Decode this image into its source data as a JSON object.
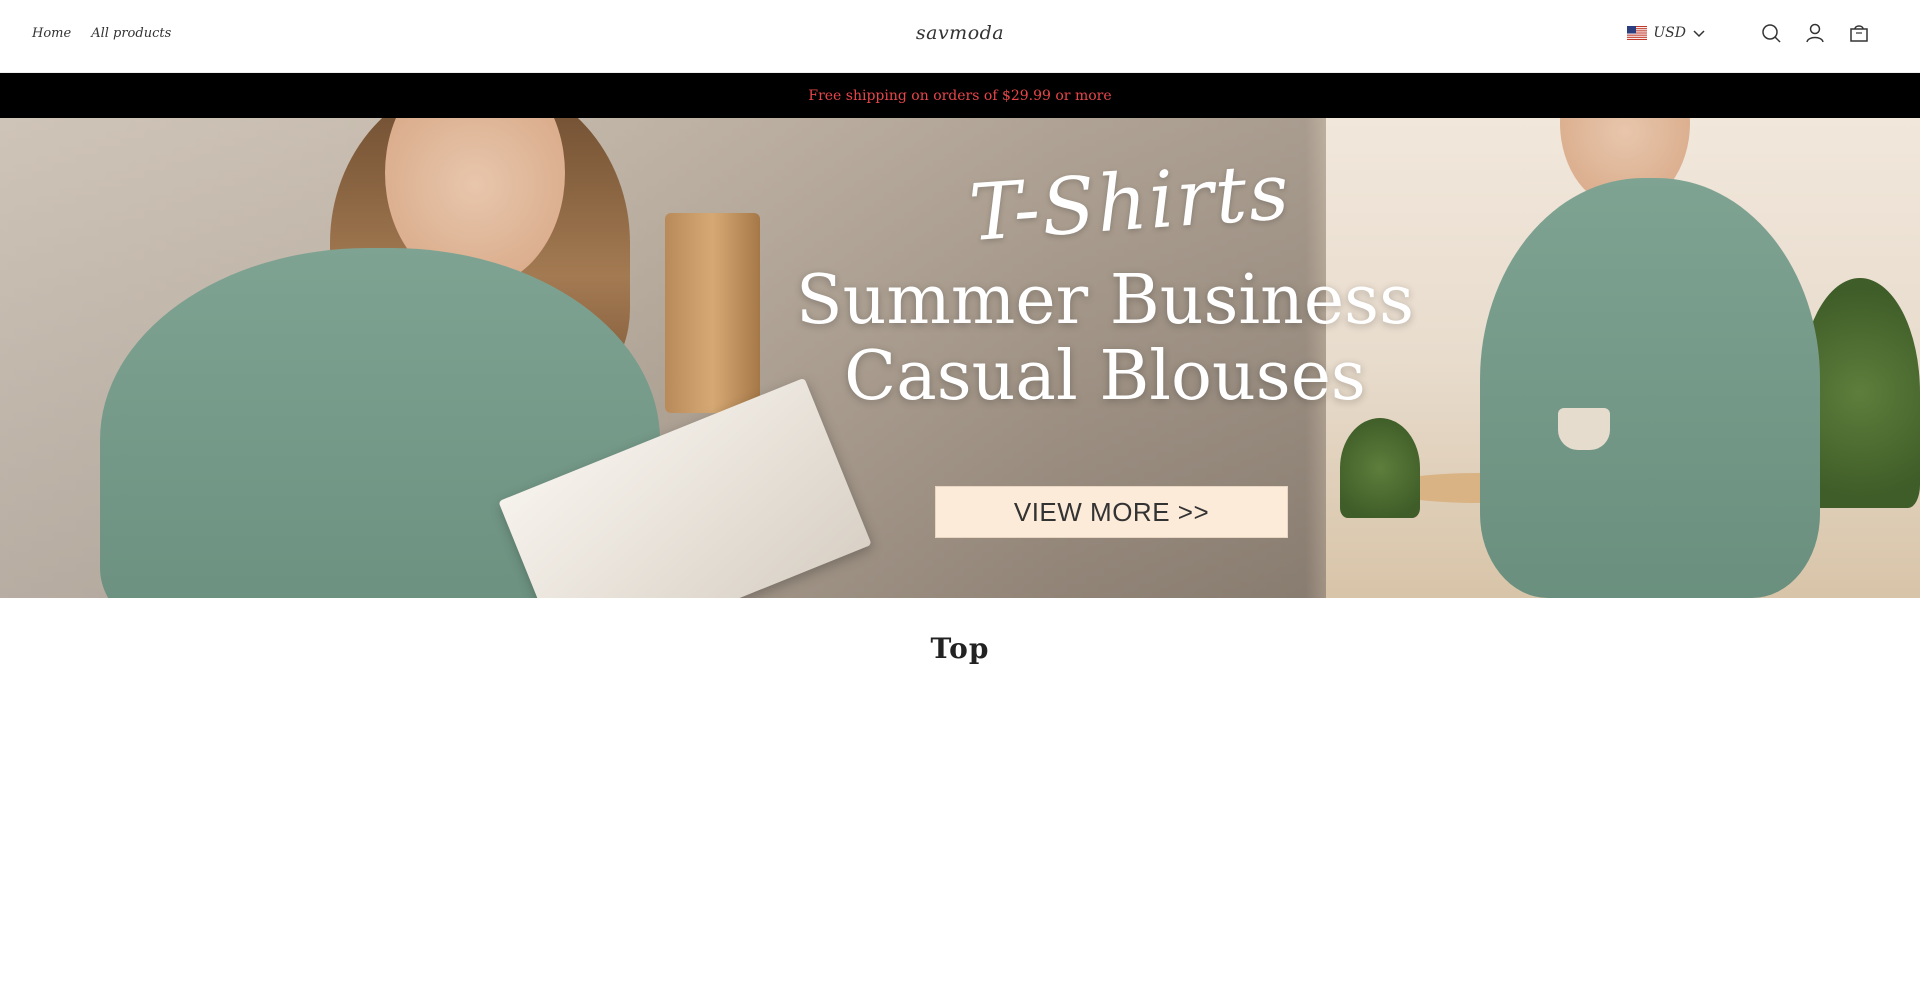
{
  "header": {
    "nav": [
      {
        "label": "Home"
      },
      {
        "label": "All products"
      }
    ],
    "brand": "savmoda",
    "currency": {
      "label": "USD",
      "flag_icon": "us-flag-icon"
    },
    "icons": [
      "search-icon",
      "account-icon",
      "cart-icon"
    ]
  },
  "announcement": {
    "text": "Free shipping on orders of $29.99 or more",
    "text_color": "#e8464a",
    "background": "#000000"
  },
  "hero": {
    "script_text": "T-Shirts",
    "title_line1": "Summer Business",
    "title_line2": "Casual Blouses",
    "button_label": "VIEW MORE >>",
    "button_color": "#fdebd9"
  },
  "section": {
    "title": "Top"
  }
}
